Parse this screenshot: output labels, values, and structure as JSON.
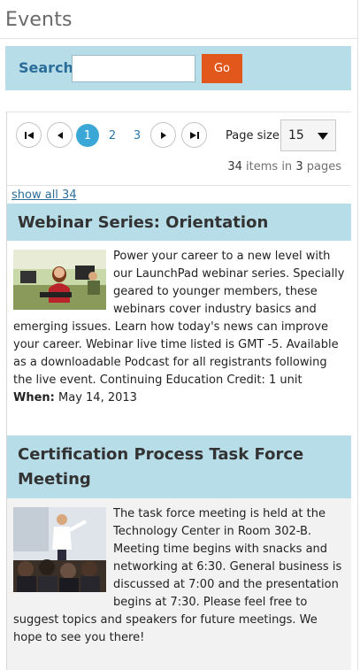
{
  "page": {
    "title": "Events"
  },
  "search": {
    "label": "Search",
    "value": "",
    "placeholder": "",
    "button": "Go"
  },
  "pager": {
    "pages": [
      "1",
      "2",
      "3"
    ],
    "current": "1",
    "page_size_label": "Page size:",
    "page_size_value": "15",
    "total_items": "34",
    "items_in_text": "items in",
    "total_pages": "3",
    "pages_text": "pages"
  },
  "show_all": "show all 34",
  "events": [
    {
      "title": "Webinar Series: Orientation",
      "description": "Power your career to a new level with our LaunchPad webinar series. Specially geared to younger members, these webinars cover industry basics and emerging issues. Learn how today's news can improve your career. Webinar live time listed is GMT -5. Available as a downloadable Podcast for all registrants following the live event. Continuing Education Credit: 1 unit",
      "when_label": "When:",
      "when_value": "May 14, 2013",
      "image_icon": "computer-lab-photo"
    },
    {
      "title": "Certification Process Task Force Meeting",
      "description": "The task force meeting is held at the Technology Center in Room 302-B. Meeting time begins with snacks and networking at 6:30. General business is discussed at 7:00 and the presentation begins at 7:30. Please feel free to suggest topics and speakers for future meetings. We hope to see you there!",
      "image_icon": "presentation-audience-photo"
    }
  ],
  "colors": {
    "header_bg": "#b7dde8",
    "accent_blue": "#2b6d9a",
    "go_orange": "#e2571c",
    "active_page": "#3aa7d6"
  }
}
